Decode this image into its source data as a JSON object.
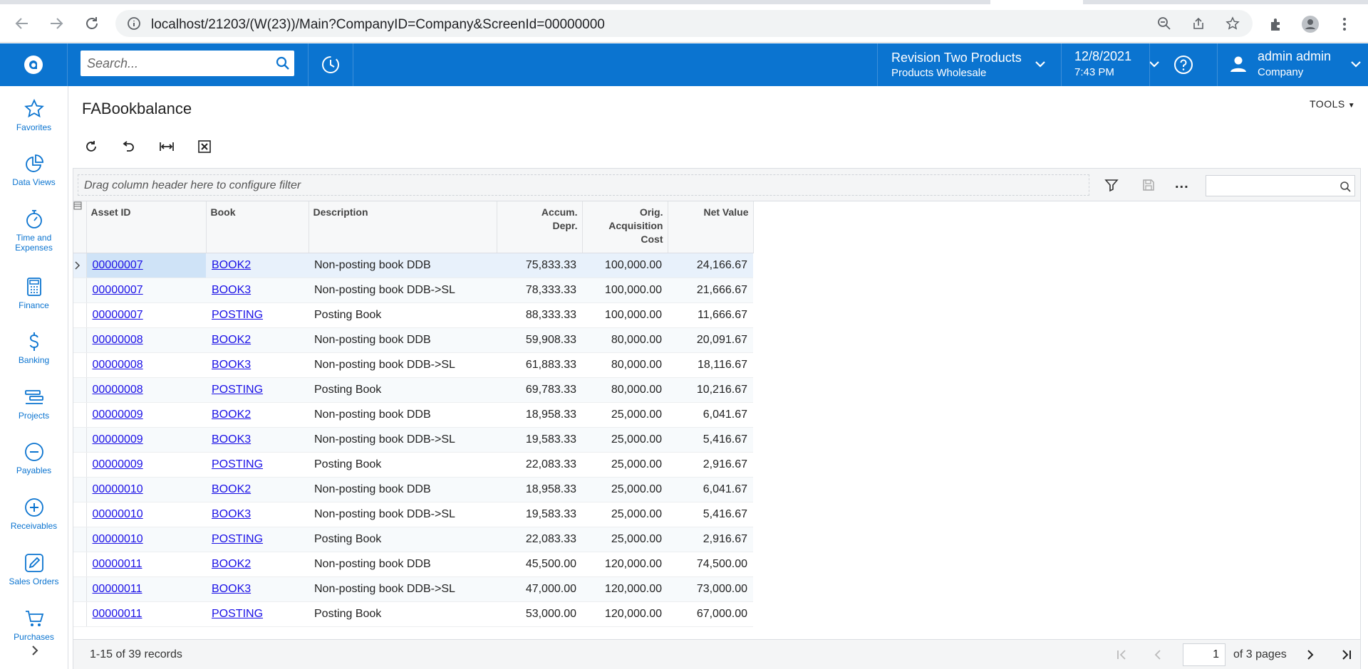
{
  "browser": {
    "url": "localhost/21203/(W(23))/Main?CompanyID=Company&ScreenId=00000000"
  },
  "header": {
    "search_placeholder": "Search...",
    "company_name": "Revision Two Products",
    "branch_name": "Products Wholesale",
    "date": "12/8/2021",
    "time": "7:43 PM",
    "user_name": "admin admin",
    "user_company": "Company"
  },
  "sidebar": {
    "items": [
      {
        "label": "Favorites",
        "icon": "star-icon"
      },
      {
        "label": "Data Views",
        "icon": "pie-chart-icon"
      },
      {
        "label": "Time and Expenses",
        "icon": "stopwatch-icon"
      },
      {
        "label": "Finance",
        "icon": "calculator-icon"
      },
      {
        "label": "Banking",
        "icon": "dollar-icon"
      },
      {
        "label": "Projects",
        "icon": "projects-icon"
      },
      {
        "label": "Payables",
        "icon": "minus-circle-icon"
      },
      {
        "label": "Receivables",
        "icon": "plus-circle-icon"
      },
      {
        "label": "Sales Orders",
        "icon": "pencil-icon"
      },
      {
        "label": "Purchases",
        "icon": "cart-icon"
      }
    ]
  },
  "page": {
    "title": "FABookbalance",
    "tools_label": "TOOLS"
  },
  "grid": {
    "filter_hint": "Drag column header here to configure filter",
    "columns": [
      "Asset ID",
      "Book",
      "Description",
      "Accum. Depr.",
      "Orig. Acquisition Cost",
      "Net Value"
    ],
    "rows": [
      [
        "00000007",
        "BOOK2",
        "Non-posting book DDB",
        "75,833.33",
        "100,000.00",
        "24,166.67"
      ],
      [
        "00000007",
        "BOOK3",
        "Non-posting book DDB->SL",
        "78,333.33",
        "100,000.00",
        "21,666.67"
      ],
      [
        "00000007",
        "POSTING",
        "Posting Book",
        "88,333.33",
        "100,000.00",
        "11,666.67"
      ],
      [
        "00000008",
        "BOOK2",
        "Non-posting book DDB",
        "59,908.33",
        "80,000.00",
        "20,091.67"
      ],
      [
        "00000008",
        "BOOK3",
        "Non-posting book DDB->SL",
        "61,883.33",
        "80,000.00",
        "18,116.67"
      ],
      [
        "00000008",
        "POSTING",
        "Posting Book",
        "69,783.33",
        "80,000.00",
        "10,216.67"
      ],
      [
        "00000009",
        "BOOK2",
        "Non-posting book DDB",
        "18,958.33",
        "25,000.00",
        "6,041.67"
      ],
      [
        "00000009",
        "BOOK3",
        "Non-posting book DDB->SL",
        "19,583.33",
        "25,000.00",
        "5,416.67"
      ],
      [
        "00000009",
        "POSTING",
        "Posting Book",
        "22,083.33",
        "25,000.00",
        "2,916.67"
      ],
      [
        "00000010",
        "BOOK2",
        "Non-posting book DDB",
        "18,958.33",
        "25,000.00",
        "6,041.67"
      ],
      [
        "00000010",
        "BOOK3",
        "Non-posting book DDB->SL",
        "19,583.33",
        "25,000.00",
        "5,416.67"
      ],
      [
        "00000010",
        "POSTING",
        "Posting Book",
        "22,083.33",
        "25,000.00",
        "2,916.67"
      ],
      [
        "00000011",
        "BOOK2",
        "Non-posting book DDB",
        "45,500.00",
        "120,000.00",
        "74,500.00"
      ],
      [
        "00000011",
        "BOOK3",
        "Non-posting book DDB->SL",
        "47,000.00",
        "120,000.00",
        "73,000.00"
      ],
      [
        "00000011",
        "POSTING",
        "Posting Book",
        "53,000.00",
        "120,000.00",
        "67,000.00"
      ]
    ],
    "records_text": "1-15 of 39 records",
    "page_value": "1",
    "of_pages_text": "of 3 pages"
  },
  "colors": {
    "brand_blue": "#0b74d0",
    "link": "#1a10e6"
  }
}
